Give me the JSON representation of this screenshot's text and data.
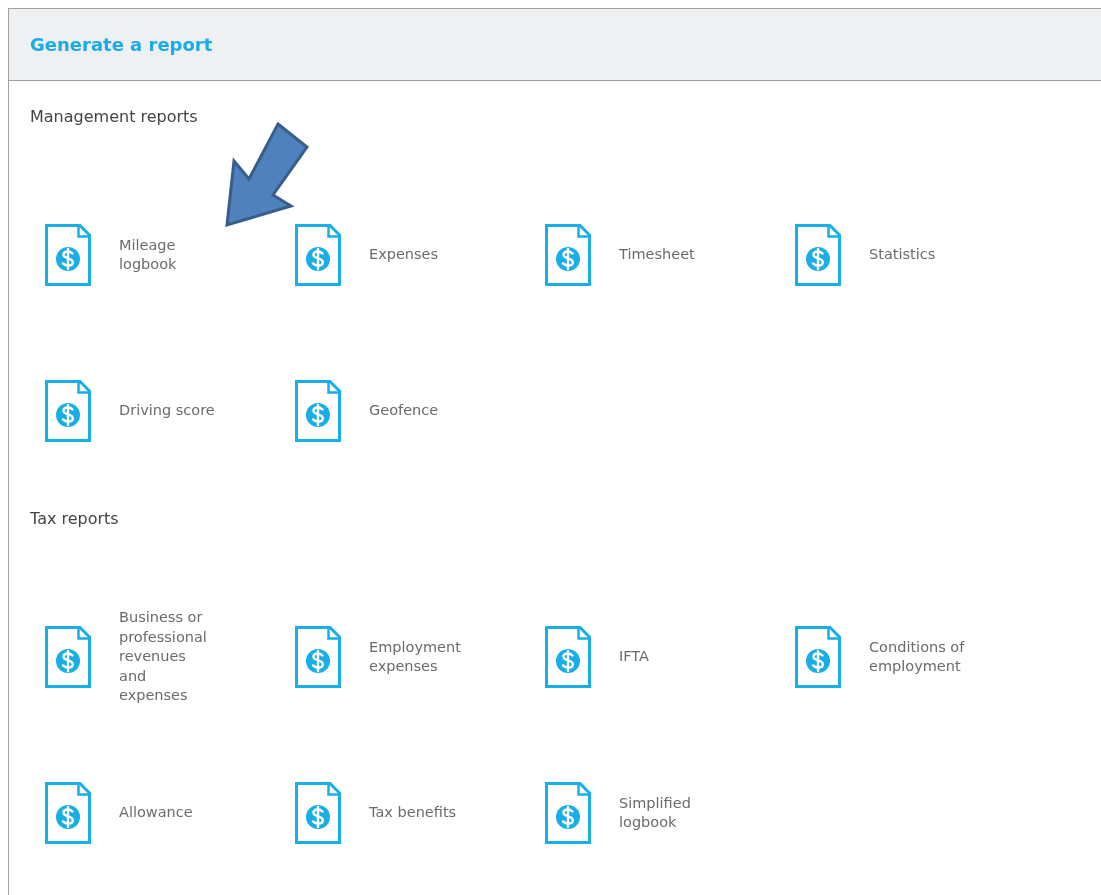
{
  "header": {
    "title": "Generate a report"
  },
  "sections": [
    {
      "title": "Management reports",
      "reports": [
        {
          "label": "Mileage\nlogbook"
        },
        {
          "label": "Expenses"
        },
        {
          "label": "Timesheet"
        },
        {
          "label": "Statistics"
        },
        {
          "label": "Driving score"
        },
        {
          "label": "Geofence"
        }
      ]
    },
    {
      "title": "Tax reports",
      "reports": [
        {
          "label": "Business or\nprofessional\nrevenues\nand\nexpenses"
        },
        {
          "label": "Employment\nexpenses"
        },
        {
          "label": "IFTA"
        },
        {
          "label": "Conditions of\nemployment"
        },
        {
          "label": "Allowance"
        },
        {
          "label": "Tax benefits"
        },
        {
          "label": "Simplified\nlogbook"
        }
      ]
    }
  ],
  "annotations": [
    {
      "kind": "arrow"
    }
  ]
}
